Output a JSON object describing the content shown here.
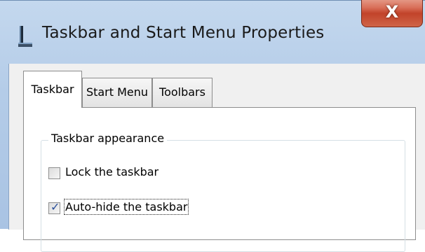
{
  "window": {
    "title": "Taskbar and Start Menu Properties",
    "icon": "taskbar-app-icon",
    "close_symbol": "X"
  },
  "tabs": [
    {
      "label": "Taskbar",
      "active": true
    },
    {
      "label": "Start Menu",
      "active": false
    },
    {
      "label": "Toolbars",
      "active": false
    }
  ],
  "taskbar_appearance": {
    "group_label": "Taskbar appearance",
    "options": [
      {
        "label": "Lock the taskbar",
        "checked": false
      },
      {
        "label": "Auto-hide the taskbar",
        "checked": true
      }
    ]
  },
  "colors": {
    "title_bar": "#b4cce8",
    "close_button": "#c2432a",
    "dialog_background": "#f0f0f0",
    "check_mark": "#2a4f9a"
  }
}
